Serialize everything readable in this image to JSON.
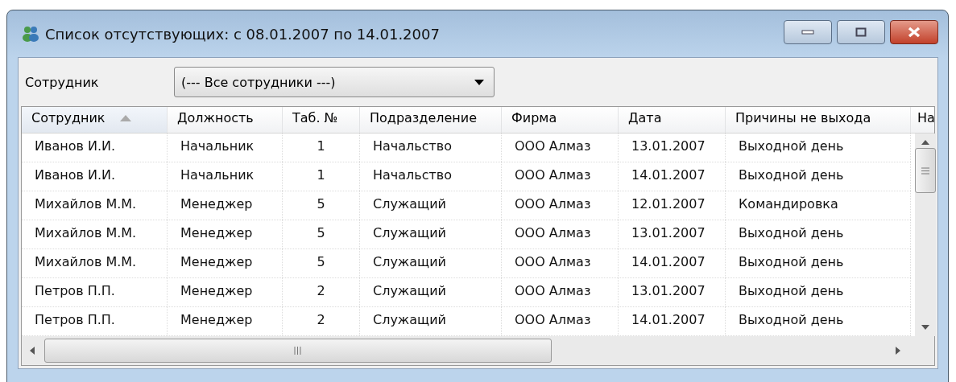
{
  "window": {
    "title": "Список отсутствующих: с 08.01.2007 по 14.01.2007"
  },
  "filter": {
    "label": "Сотрудник",
    "value": "(--- Все сотрудники ---)"
  },
  "table": {
    "columns": [
      {
        "label": "Сотрудник",
        "sorted": true
      },
      {
        "label": "Должность",
        "sorted": false
      },
      {
        "label": "Таб. №",
        "sorted": false
      },
      {
        "label": "Подразделение",
        "sorted": false
      },
      {
        "label": "Фирма",
        "sorted": false
      },
      {
        "label": "Дата",
        "sorted": false
      },
      {
        "label": "Причины не выхода",
        "sorted": false
      },
      {
        "label": "На",
        "sorted": false
      }
    ],
    "rows": [
      [
        "Иванов И.И.",
        "Начальник",
        "1",
        "Начальство",
        "ООО Алмаз",
        "13.01.2007",
        "Выходной день"
      ],
      [
        "Иванов И.И.",
        "Начальник",
        "1",
        "Начальство",
        "ООО Алмаз",
        "14.01.2007",
        "Выходной день"
      ],
      [
        "Михайлов М.М.",
        "Менеджер",
        "5",
        "Служащий",
        "ООО Алмаз",
        "12.01.2007",
        "Командировка"
      ],
      [
        "Михайлов М.М.",
        "Менеджер",
        "5",
        "Служащий",
        "ООО Алмаз",
        "13.01.2007",
        "Выходной день"
      ],
      [
        "Михайлов М.М.",
        "Менеджер",
        "5",
        "Служащий",
        "ООО Алмаз",
        "14.01.2007",
        "Выходной день"
      ],
      [
        "Петров П.П.",
        "Менеджер",
        "2",
        "Служащий",
        "ООО Алмаз",
        "13.01.2007",
        "Выходной день"
      ],
      [
        "Петров П.П.",
        "Менеджер",
        "2",
        "Служащий",
        "ООО Алмаз",
        "14.01.2007",
        "Выходной день"
      ]
    ]
  }
}
